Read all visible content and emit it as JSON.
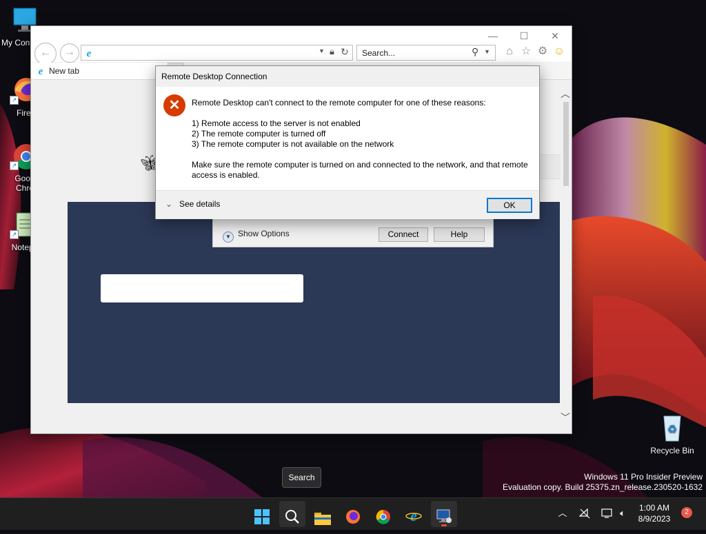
{
  "desktop": {
    "icons": [
      {
        "label": "My Con",
        "icon": "computer-icon"
      },
      {
        "label": "Firef",
        "icon": "firefox-icon"
      },
      {
        "label": "Goog\nChro",
        "label_line1": "Goog",
        "label_line2": "Chro",
        "icon": "chrome-icon"
      },
      {
        "label": "Notepa",
        "icon": "notepad-icon"
      },
      {
        "label": "Recycle Bin",
        "icon": "recycle-bin-icon"
      }
    ]
  },
  "browser": {
    "search_placeholder": "Search...",
    "tab_label": "New tab"
  },
  "rdc_dialog": {
    "show_options_label": "Show Options",
    "connect_label": "Connect",
    "help_label": "Help"
  },
  "error_dialog": {
    "title": "Remote Desktop Connection",
    "intro": "Remote Desktop can't connect to the remote computer for one of these reasons:",
    "reasons": [
      "1) Remote access to the server is not enabled",
      "2) The remote computer is turned off",
      "3) The remote computer is not available on the network"
    ],
    "advice": "Make sure the remote computer is turned on and connected to the network, and that remote access is enabled.",
    "see_details_label": "See details",
    "ok_label": "OK"
  },
  "tooltip": {
    "text": "Search"
  },
  "watermark": {
    "line1": "Windows 11 Pro Insider Preview",
    "line2": "Evaluation copy. Build 25375.zn_release.230520-1632"
  },
  "taskbar": {
    "apps": [
      "start-icon",
      "search-icon",
      "file-explorer-icon",
      "firefox-icon",
      "chrome-icon",
      "internet-explorer-icon",
      "remote-desktop-icon"
    ],
    "clock_time": "1:00 AM",
    "clock_date": "8/9/2023",
    "notification_count": "2"
  },
  "colors": {
    "accent": "#0078d7",
    "error_red": "#d83b01",
    "dark_panel": "#2b3856",
    "taskbar": "#1f1f1f"
  }
}
